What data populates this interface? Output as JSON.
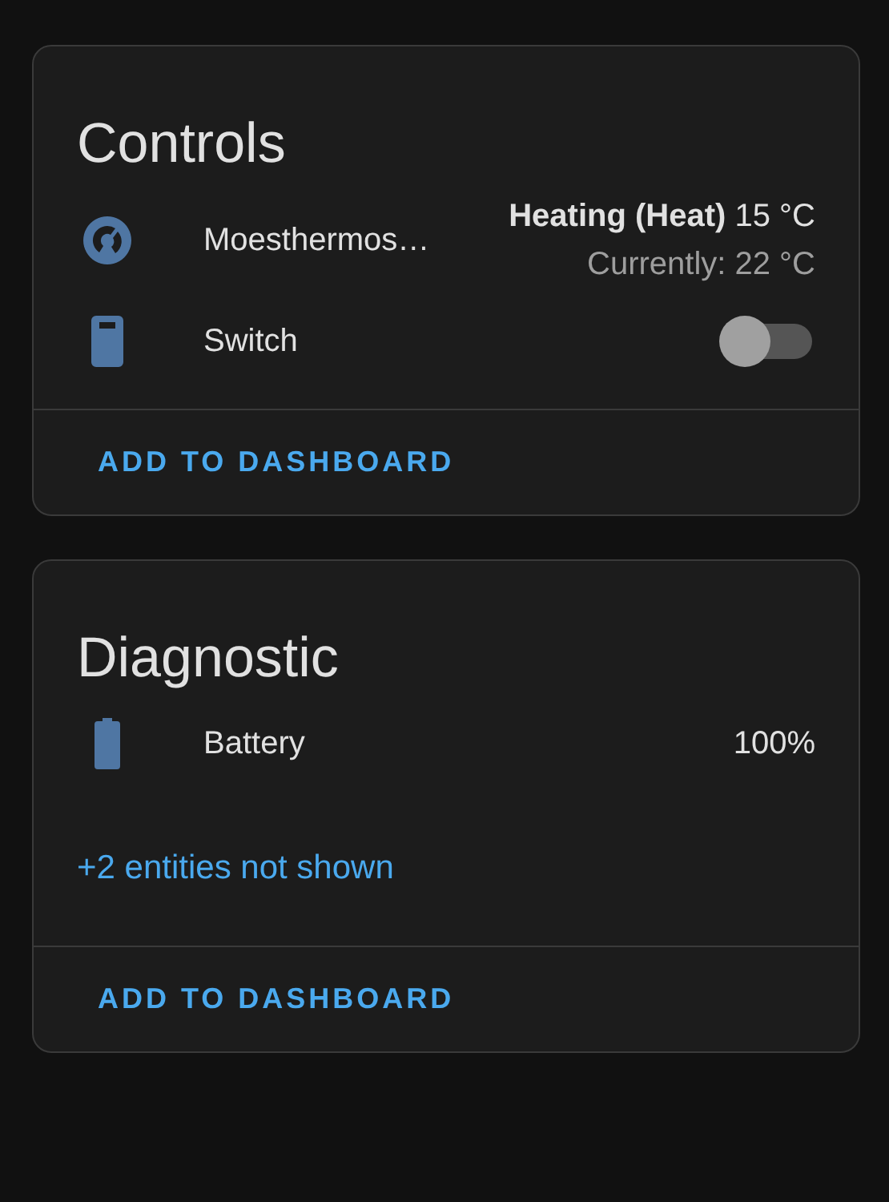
{
  "cards": [
    {
      "title": "Controls",
      "entities": [
        {
          "kind": "climate",
          "name": "Moesthermos…",
          "state": "**Heating (Heat)** 15 °C",
          "current": "Currently: 22 °C"
        },
        {
          "kind": "switch",
          "name": "Switch",
          "on": false
        }
      ],
      "footer_button": "ADD TO DASHBOARD"
    },
    {
      "title": "Diagnostic",
      "entities": [
        {
          "kind": "battery",
          "name": "Battery",
          "value": "100%"
        }
      ],
      "more_link": "+2 entities not shown",
      "footer_button": "ADD TO DASHBOARD"
    }
  ]
}
